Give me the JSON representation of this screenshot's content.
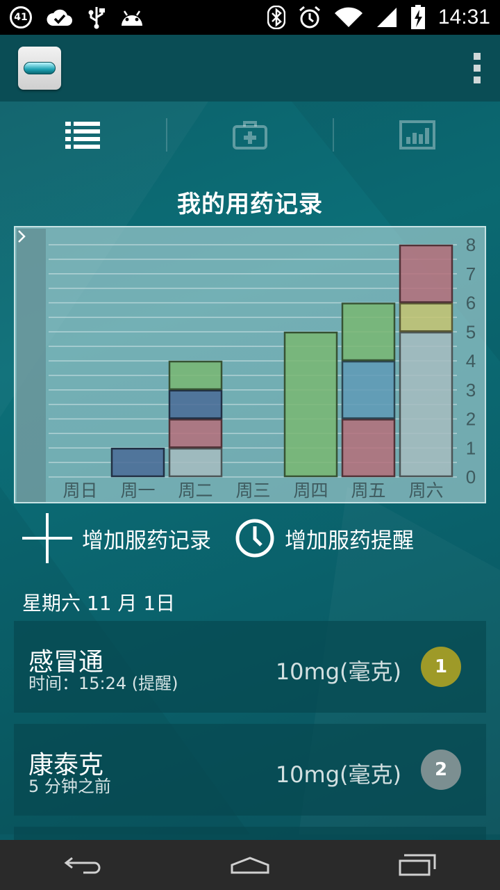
{
  "status_bar": {
    "notification_count": "41",
    "time": "14:31"
  },
  "action_bar": {
    "icons": [
      "app-pill-icon",
      "overflow-menu-icon"
    ]
  },
  "tabs": [
    {
      "icon": "list-icon",
      "active": true
    },
    {
      "icon": "medical-kit-icon",
      "active": false
    },
    {
      "icon": "bar-chart-icon",
      "active": false
    }
  ],
  "page_title": "我的用药记录",
  "chart_data": {
    "type": "bar",
    "stacked": true,
    "categories": [
      "周日",
      "周一",
      "周二",
      "周三",
      "周四",
      "周五",
      "周六"
    ],
    "ylim": [
      0,
      8
    ],
    "y_ticks": [
      "0",
      "1",
      "2",
      "3",
      "4",
      "5",
      "6",
      "7",
      "8"
    ],
    "y_axis_side": "right",
    "grid": true,
    "stacks": [
      [],
      [
        {
          "value": 1,
          "color": "#4a6b96"
        }
      ],
      [
        {
          "value": 1,
          "color": "#a6bcc0"
        },
        {
          "value": 1,
          "color": "#b56f7a"
        },
        {
          "value": 1,
          "color": "#4a6b96"
        },
        {
          "value": 1,
          "color": "#79b772"
        }
      ],
      [],
      [
        {
          "value": 5,
          "color": "#79b772"
        }
      ],
      [
        {
          "value": 2,
          "color": "#b56f7a"
        },
        {
          "value": 2,
          "color": "#5f9ab6"
        },
        {
          "value": 2,
          "color": "#79b772"
        }
      ],
      [
        {
          "value": 5,
          "color": "#a6bcc0"
        },
        {
          "value": 1,
          "color": "#c6c471"
        },
        {
          "value": 2,
          "color": "#b56f7a"
        }
      ]
    ]
  },
  "actions": {
    "add_record": "增加服药记录",
    "add_reminder": "增加服药提醒"
  },
  "date_header": "星期六 11 月 1日",
  "entries": [
    {
      "name": "感冒通",
      "sub": "时间：15:24 (提醒)",
      "dose": "10mg(毫克)",
      "count": "1",
      "count_color": "#9e9a28"
    },
    {
      "name": "康泰克",
      "sub": "5 分钟之前",
      "dose": "10mg(毫克)",
      "count": "2",
      "count_color": "#7c8f91"
    }
  ]
}
